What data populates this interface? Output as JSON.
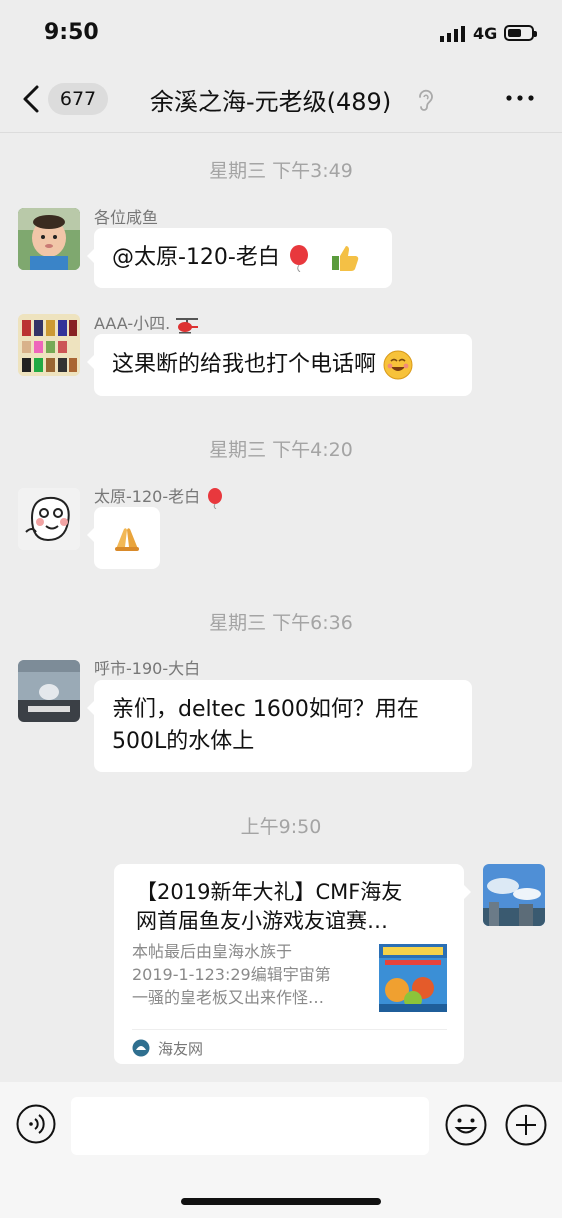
{
  "status_bar": {
    "time": "9:50",
    "network": "4G",
    "battery_level": 0.6
  },
  "nav": {
    "unread_count": "677",
    "title": "余溪之海-元老级(489)"
  },
  "chat": {
    "ts1": "星期三 下午3:49",
    "msg1": {
      "sender": "各位咸鱼",
      "text": "@太原-120-老白"
    },
    "msg2": {
      "sender": "AAA-小四.",
      "text": "这果断的给我也打个电话啊"
    },
    "ts2": "星期三 下午4:20",
    "msg3": {
      "sender": "太原-120-老白"
    },
    "ts3": "星期三 下午6:36",
    "msg4": {
      "sender": "呼市-190-大白",
      "line1": "亲们，deltec 1600如何？用在",
      "line2": "500L的水体上"
    },
    "ts4": "上午9:50",
    "link_card": {
      "title_line1": "【2019新年大礼】CMF海友",
      "title_line2": "网首届鱼友小游戏友谊赛…",
      "desc_line1": "本帖最后由皇海水族于",
      "desc_line2": "2019-1-123:29编辑宇宙第",
      "desc_line3": "一骚的皇老板又出来作怪…",
      "source": "海友网"
    }
  },
  "icons": {
    "balloon": "balloon-icon",
    "thumbs_up": "thumbs-up-icon",
    "smile": "smile-icon",
    "helicopter": "helicopter-icon",
    "hands": "folded-hands-icon"
  }
}
